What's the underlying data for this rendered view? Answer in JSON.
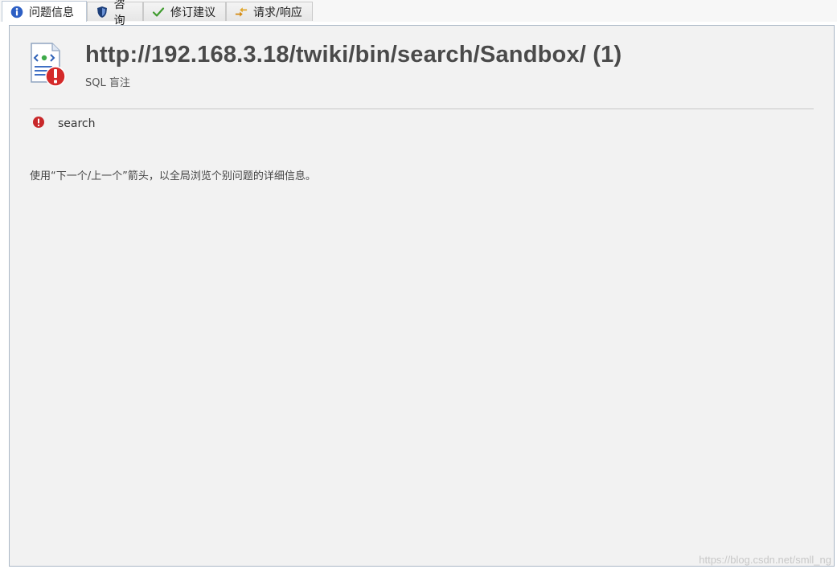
{
  "tabs": [
    {
      "label": "问题信息",
      "icon": "info-icon",
      "active": true
    },
    {
      "label": "咨询",
      "icon": "shield-icon",
      "active": false
    },
    {
      "label": "修订建议",
      "icon": "checkmark-icon",
      "active": false
    },
    {
      "label": "请求/响应",
      "icon": "arrows-icon",
      "active": false
    }
  ],
  "issue": {
    "title": "http://192.168.3.18/twiki/bin/search/Sandbox/ (1)",
    "subtitle": "SQL 盲注",
    "item_label": "search",
    "item_icon": "error-icon"
  },
  "hint": "使用“下一个/上一个”箭头，以全局浏览个别问题的详细信息。",
  "watermark": "https://blog.csdn.net/smll_ng",
  "colors": {
    "error": "#c8282a",
    "border": "#aab7c6",
    "panel_bg": "#f2f2f2"
  }
}
